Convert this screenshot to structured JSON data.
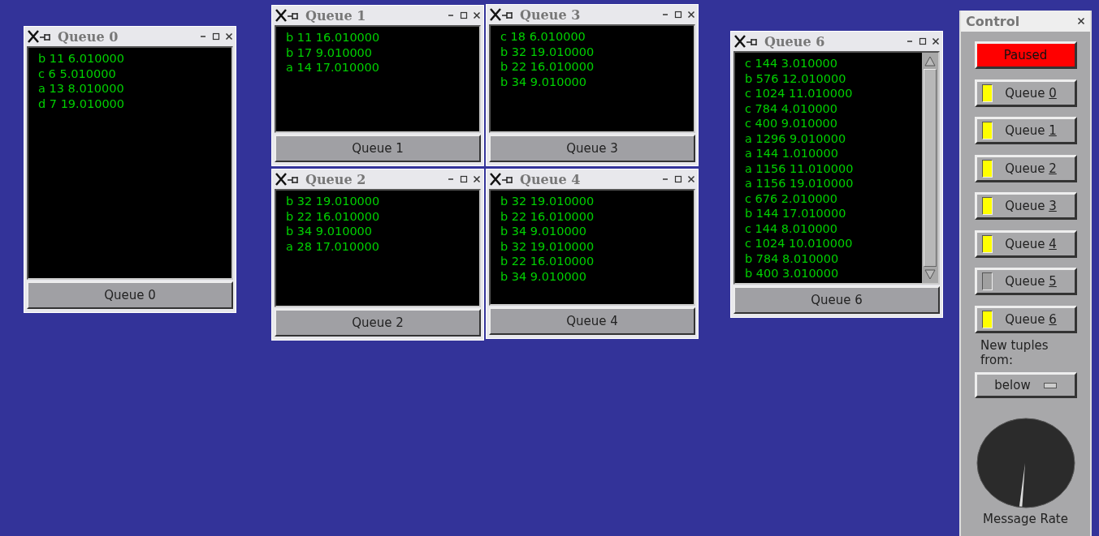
{
  "windows": [
    {
      "title": "Queue 0",
      "lines": [
        "b 11 6.010000",
        "c 6 5.010000",
        "a 13 8.010000",
        "d 7 19.010000"
      ],
      "button": "Queue 0",
      "scrollable": false
    },
    {
      "title": "Queue 1",
      "lines": [
        "b 11 16.010000",
        "b 17 9.010000",
        "a 14 17.010000"
      ],
      "button": "Queue 1",
      "scrollable": false
    },
    {
      "title": "Queue 3",
      "lines": [
        "c 18 6.010000",
        "b 32 19.010000",
        "b 22 16.010000",
        "b 34 9.010000"
      ],
      "button": "Queue 3",
      "scrollable": false
    },
    {
      "title": "Queue 2",
      "lines": [
        "b 32 19.010000",
        "b 22 16.010000",
        "b 34 9.010000",
        "a 28 17.010000"
      ],
      "button": "Queue 2",
      "scrollable": false
    },
    {
      "title": "Queue 4",
      "lines": [
        "b 32 19.010000",
        "b 22 16.010000",
        "b 34 9.010000",
        "b 32 19.010000",
        "b 22 16.010000",
        "b 34 9.010000"
      ],
      "button": "Queue 4",
      "scrollable": false
    },
    {
      "title": "Queue 6",
      "lines": [
        "c 144 3.010000",
        "b 576 12.010000",
        "c 1024 11.010000",
        "c 784 4.010000",
        "c 400 9.010000",
        "a 1296 9.010000",
        "a 144 1.010000",
        "a 1156 11.010000",
        "a 1156 19.010000",
        "c 676 2.010000",
        "b 144 17.010000",
        "c 144 8.010000",
        "c 1024 10.010000",
        "b 784 8.010000",
        "b 400 3.010000"
      ],
      "button": "Queue 6",
      "scrollable": true
    }
  ],
  "control": {
    "title": "Control",
    "status_button": "Paused",
    "queues": [
      {
        "label": "Queue",
        "key": "0",
        "on": true
      },
      {
        "label": "Queue",
        "key": "1",
        "on": true
      },
      {
        "label": "Queue",
        "key": "2",
        "on": true
      },
      {
        "label": "Queue",
        "key": "3",
        "on": true
      },
      {
        "label": "Queue",
        "key": "4",
        "on": true
      },
      {
        "label": "Queue",
        "key": "5",
        "on": false
      },
      {
        "label": "Queue",
        "key": "6",
        "on": true
      }
    ],
    "source_label": "New tuples from:",
    "source_value": "below",
    "rate": {
      "label": "Message Rate"
    }
  }
}
